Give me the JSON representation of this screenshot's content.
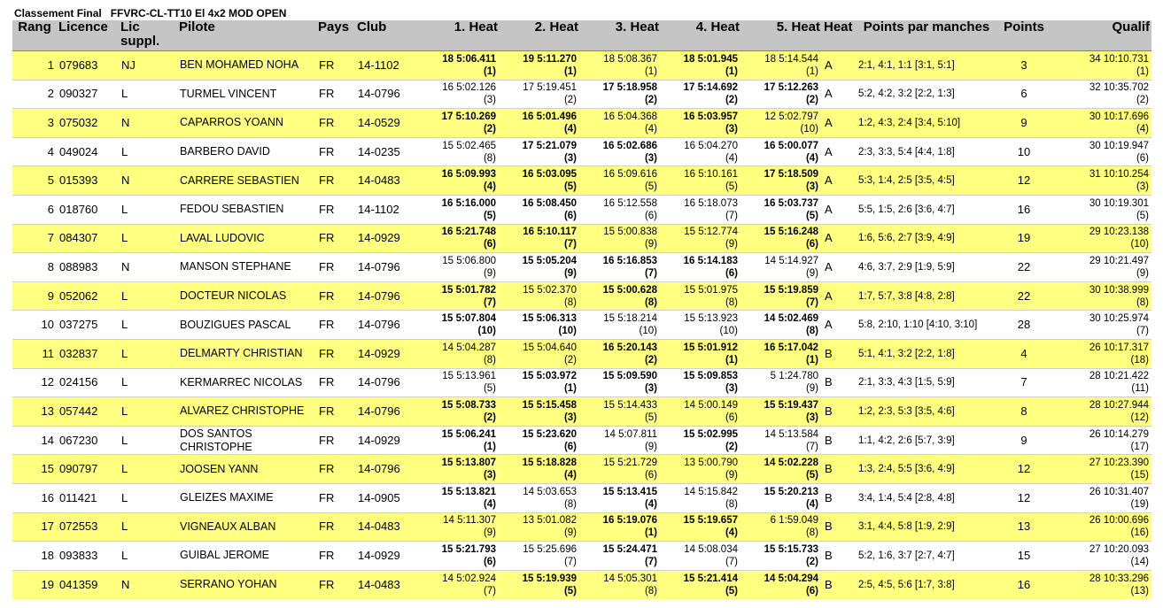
{
  "title": {
    "left": "Classement Final",
    "right": "FFVRC-CL-TT10 El 4x2 MOD OPEN"
  },
  "headers": [
    "Rang",
    "Licence",
    "Lic suppl.",
    "Pilote",
    "Pays",
    "Club",
    "1. Heat",
    "2. Heat",
    "3. Heat",
    "4. Heat",
    "5. Heat",
    "Heat",
    "Points par manches",
    "Points",
    "Qualif"
  ],
  "rows": [
    {
      "rang": "1",
      "licence": "079683",
      "lic": "NJ",
      "pilote": "BEN MOHAMED NOHA",
      "pays": "FR",
      "club": "14-1102",
      "heats": [
        {
          "t": "18 5:06.411",
          "p": "(1)",
          "b": true
        },
        {
          "t": "19 5:11.270",
          "p": "(1)",
          "b": true
        },
        {
          "t": "18 5:08.367",
          "p": "(1)",
          "b": false
        },
        {
          "t": "18 5:01.945",
          "p": "(1)",
          "b": true
        },
        {
          "t": "18 5:14.544",
          "p": "(1)",
          "b": false
        }
      ],
      "heat": "A",
      "pm": "2:1, 4:1, 1:1 [3:1, 5:1]",
      "points": "3",
      "q1": "34 10:10.731",
      "q2": "(1)"
    },
    {
      "rang": "2",
      "licence": "090327",
      "lic": "L",
      "pilote": "TURMEL VINCENT",
      "pays": "FR",
      "club": "14-0796",
      "heats": [
        {
          "t": "16 5:02.126",
          "p": "(3)",
          "b": false
        },
        {
          "t": "17 5:19.451",
          "p": "(2)",
          "b": false
        },
        {
          "t": "17 5:18.958",
          "p": "(2)",
          "b": true
        },
        {
          "t": "17 5:14.692",
          "p": "(2)",
          "b": true
        },
        {
          "t": "17 5:12.263",
          "p": "(2)",
          "b": true
        }
      ],
      "heat": "A",
      "pm": "5:2, 4:2, 3:2 [2:2, 1:3]",
      "points": "6",
      "q1": "32 10:35.702",
      "q2": "(2)"
    },
    {
      "rang": "3",
      "licence": "075032",
      "lic": "N",
      "pilote": "CAPARROS YOANN",
      "pays": "FR",
      "club": "14-0529",
      "heats": [
        {
          "t": "17 5:10.269",
          "p": "(2)",
          "b": true
        },
        {
          "t": "16 5:01.496",
          "p": "(4)",
          "b": true
        },
        {
          "t": "16 5:04.368",
          "p": "(4)",
          "b": false
        },
        {
          "t": "16 5:03.957",
          "p": "(3)",
          "b": true
        },
        {
          "t": "12 5:02.797",
          "p": "(10)",
          "b": false
        }
      ],
      "heat": "A",
      "pm": "1:2, 4:3, 2:4 [3:4, 5:10]",
      "points": "9",
      "q1": "30 10:17.696",
      "q2": "(4)"
    },
    {
      "rang": "4",
      "licence": "049024",
      "lic": "L",
      "pilote": "BARBERO DAVID",
      "pays": "FR",
      "club": "14-0235",
      "heats": [
        {
          "t": "15 5:02.465",
          "p": "(8)",
          "b": false
        },
        {
          "t": "17 5:21.079",
          "p": "(3)",
          "b": true
        },
        {
          "t": "16 5:02.686",
          "p": "(3)",
          "b": true
        },
        {
          "t": "16 5:04.270",
          "p": "(4)",
          "b": false
        },
        {
          "t": "16 5:00.077",
          "p": "(4)",
          "b": true
        }
      ],
      "heat": "A",
      "pm": "2:3, 3:3, 5:4 [4:4, 1:8]",
      "points": "10",
      "q1": "30 10:19.947",
      "q2": "(6)"
    },
    {
      "rang": "5",
      "licence": "015393",
      "lic": "N",
      "pilote": "CARRERE SEBASTIEN",
      "pays": "FR",
      "club": "14-0483",
      "heats": [
        {
          "t": "16 5:09.993",
          "p": "(4)",
          "b": true
        },
        {
          "t": "16 5:03.095",
          "p": "(5)",
          "b": true
        },
        {
          "t": "16 5:09.616",
          "p": "(5)",
          "b": false
        },
        {
          "t": "16 5:10.161",
          "p": "(5)",
          "b": false
        },
        {
          "t": "17 5:18.509",
          "p": "(3)",
          "b": true
        }
      ],
      "heat": "A",
      "pm": "5:3, 1:4, 2:5 [3:5, 4:5]",
      "points": "12",
      "q1": "31 10:10.254",
      "q2": "(3)"
    },
    {
      "rang": "6",
      "licence": "018760",
      "lic": "L",
      "pilote": "FEDOU SEBASTIEN",
      "pays": "FR",
      "club": "14-1102",
      "heats": [
        {
          "t": "16 5:16.000",
          "p": "(5)",
          "b": true
        },
        {
          "t": "16 5:08.450",
          "p": "(6)",
          "b": true
        },
        {
          "t": "16 5:12.558",
          "p": "(6)",
          "b": false
        },
        {
          "t": "16 5:18.073",
          "p": "(7)",
          "b": false
        },
        {
          "t": "16 5:03.737",
          "p": "(5)",
          "b": true
        }
      ],
      "heat": "A",
      "pm": "5:5, 1:5, 2:6 [3:6, 4:7]",
      "points": "16",
      "q1": "30 10:19.301",
      "q2": "(5)"
    },
    {
      "rang": "7",
      "licence": "084307",
      "lic": "L",
      "pilote": "LAVAL LUDOVIC",
      "pays": "FR",
      "club": "14-0929",
      "heats": [
        {
          "t": "16 5:21.748",
          "p": "(6)",
          "b": true
        },
        {
          "t": "16 5:10.117",
          "p": "(7)",
          "b": true
        },
        {
          "t": "15 5:00.838",
          "p": "(9)",
          "b": false
        },
        {
          "t": "15 5:12.774",
          "p": "(9)",
          "b": false
        },
        {
          "t": "15 5:16.248",
          "p": "(6)",
          "b": true
        }
      ],
      "heat": "A",
      "pm": "1:6, 5:6, 2:7 [3:9, 4:9]",
      "points": "19",
      "q1": "29 10:23.138",
      "q2": "(10)"
    },
    {
      "rang": "8",
      "licence": "088983",
      "lic": "N",
      "pilote": "MANSON STEPHANE",
      "pays": "FR",
      "club": "14-0796",
      "heats": [
        {
          "t": "15 5:06.800",
          "p": "(9)",
          "b": false
        },
        {
          "t": "15 5:05.204",
          "p": "(9)",
          "b": true
        },
        {
          "t": "16 5:16.853",
          "p": "(7)",
          "b": true
        },
        {
          "t": "16 5:14.183",
          "p": "(6)",
          "b": true
        },
        {
          "t": "14 5:14.927",
          "p": "(9)",
          "b": false
        }
      ],
      "heat": "A",
      "pm": "4:6, 3:7, 2:9 [1:9, 5:9]",
      "points": "22",
      "q1": "29 10:21.497",
      "q2": "(9)"
    },
    {
      "rang": "9",
      "licence": "052062",
      "lic": "L",
      "pilote": "DOCTEUR NICOLAS",
      "pays": "FR",
      "club": "14-0796",
      "heats": [
        {
          "t": "15 5:01.782",
          "p": "(7)",
          "b": true
        },
        {
          "t": "15 5:02.370",
          "p": "(8)",
          "b": false
        },
        {
          "t": "15 5:00.628",
          "p": "(8)",
          "b": true
        },
        {
          "t": "15 5:01.975",
          "p": "(8)",
          "b": false
        },
        {
          "t": "15 5:19.859",
          "p": "(7)",
          "b": true
        }
      ],
      "heat": "A",
      "pm": "1:7, 5:7, 3:8 [4:8, 2:8]",
      "points": "22",
      "q1": "30 10:38.999",
      "q2": "(8)"
    },
    {
      "rang": "10",
      "licence": "037275",
      "lic": "L",
      "pilote": "BOUZIGUES PASCAL",
      "pays": "FR",
      "club": "14-0796",
      "heats": [
        {
          "t": "15 5:07.804",
          "p": "(10)",
          "b": true
        },
        {
          "t": "15 5:06.313",
          "p": "(10)",
          "b": true
        },
        {
          "t": "15 5:18.214",
          "p": "(10)",
          "b": false
        },
        {
          "t": "15 5:13.923",
          "p": "(10)",
          "b": false
        },
        {
          "t": "14 5:02.469",
          "p": "(8)",
          "b": true
        }
      ],
      "heat": "A",
      "pm": "5:8, 2:10, 1:10 [4:10, 3:10]",
      "points": "28",
      "q1": "30 10:25.974",
      "q2": "(7)"
    },
    {
      "rang": "11",
      "licence": "032837",
      "lic": "L",
      "pilote": "DELMARTY CHRISTIAN",
      "pays": "FR",
      "club": "14-0929",
      "heats": [
        {
          "t": "14 5:04.287",
          "p": "(8)",
          "b": false
        },
        {
          "t": "15 5:04.640",
          "p": "(2)",
          "b": false
        },
        {
          "t": "16 5:20.143",
          "p": "(2)",
          "b": true
        },
        {
          "t": "15 5:01.912",
          "p": "(1)",
          "b": true
        },
        {
          "t": "16 5:17.042",
          "p": "(1)",
          "b": true
        }
      ],
      "heat": "B",
      "pm": "5:1, 4:1, 3:2 [2:2, 1:8]",
      "points": "4",
      "q1": "26 10:17.317",
      "q2": "(18)"
    },
    {
      "rang": "12",
      "licence": "024156",
      "lic": "L",
      "pilote": "KERMARREC NICOLAS",
      "pays": "FR",
      "club": "14-0796",
      "heats": [
        {
          "t": "15 5:13.961",
          "p": "(5)",
          "b": false
        },
        {
          "t": "15 5:03.972",
          "p": "(1)",
          "b": true
        },
        {
          "t": "15 5:09.590",
          "p": "(3)",
          "b": true
        },
        {
          "t": "15 5:09.853",
          "p": "(3)",
          "b": true
        },
        {
          "t": "5 1:24.780",
          "p": "(9)",
          "b": false
        }
      ],
      "heat": "B",
      "pm": "2:1, 3:3, 4:3 [1:5, 5:9]",
      "points": "7",
      "q1": "28 10:21.422",
      "q2": "(11)"
    },
    {
      "rang": "13",
      "licence": "057442",
      "lic": "L",
      "pilote": "ALVAREZ CHRISTOPHE",
      "pays": "FR",
      "club": "14-0796",
      "heats": [
        {
          "t": "15 5:08.733",
          "p": "(2)",
          "b": true
        },
        {
          "t": "15 5:15.458",
          "p": "(3)",
          "b": true
        },
        {
          "t": "15 5:14.433",
          "p": "(5)",
          "b": false
        },
        {
          "t": "14 5:00.149",
          "p": "(6)",
          "b": false
        },
        {
          "t": "15 5:19.437",
          "p": "(3)",
          "b": true
        }
      ],
      "heat": "B",
      "pm": "1:2, 2:3, 5:3 [3:5, 4:6]",
      "points": "8",
      "q1": "28 10:27.944",
      "q2": "(12)"
    },
    {
      "rang": "14",
      "licence": "067230",
      "lic": "L",
      "pilote": "DOS SANTOS CHRISTOPHE",
      "pays": "FR",
      "club": "14-0929",
      "heats": [
        {
          "t": "15 5:06.241",
          "p": "(1)",
          "b": true
        },
        {
          "t": "15 5:23.620",
          "p": "(6)",
          "b": true
        },
        {
          "t": "14 5:07.811",
          "p": "(9)",
          "b": false
        },
        {
          "t": "15 5:02.995",
          "p": "(2)",
          "b": true
        },
        {
          "t": "14 5:13.584",
          "p": "(7)",
          "b": false
        }
      ],
      "heat": "B",
      "pm": "1:1, 4:2, 2:6 [5:7, 3:9]",
      "points": "9",
      "q1": "26 10:14.279",
      "q2": "(17)"
    },
    {
      "rang": "15",
      "licence": "090797",
      "lic": "L",
      "pilote": "JOOSEN YANN",
      "pays": "FR",
      "club": "14-0796",
      "heats": [
        {
          "t": "15 5:13.807",
          "p": "(3)",
          "b": true
        },
        {
          "t": "15 5:18.828",
          "p": "(4)",
          "b": true
        },
        {
          "t": "15 5:21.729",
          "p": "(6)",
          "b": false
        },
        {
          "t": "13 5:00.790",
          "p": "(9)",
          "b": false
        },
        {
          "t": "14 5:02.228",
          "p": "(5)",
          "b": true
        }
      ],
      "heat": "B",
      "pm": "1:3, 2:4, 5:5 [3:6, 4:9]",
      "points": "12",
      "q1": "27 10:23.390",
      "q2": "(15)"
    },
    {
      "rang": "16",
      "licence": "011421",
      "lic": "L",
      "pilote": "GLEIZES MAXIME",
      "pays": "FR",
      "club": "14-0905",
      "heats": [
        {
          "t": "15 5:13.821",
          "p": "(4)",
          "b": true
        },
        {
          "t": "14 5:03.653",
          "p": "(8)",
          "b": false
        },
        {
          "t": "15 5:13.415",
          "p": "(4)",
          "b": true
        },
        {
          "t": "14 5:15.842",
          "p": "(8)",
          "b": false
        },
        {
          "t": "15 5:20.213",
          "p": "(4)",
          "b": true
        }
      ],
      "heat": "B",
      "pm": "3:4, 1:4, 5:4 [2:8, 4:8]",
      "points": "12",
      "q1": "26 10:31.407",
      "q2": "(19)"
    },
    {
      "rang": "17",
      "licence": "072553",
      "lic": "L",
      "pilote": "VIGNEAUX ALBAN",
      "pays": "FR",
      "club": "14-0483",
      "heats": [
        {
          "t": "14 5:11.307",
          "p": "(9)",
          "b": false
        },
        {
          "t": "13 5:01.082",
          "p": "(9)",
          "b": false
        },
        {
          "t": "16 5:19.076",
          "p": "(1)",
          "b": true
        },
        {
          "t": "15 5:19.657",
          "p": "(4)",
          "b": true
        },
        {
          "t": "6 1:59.049",
          "p": "(8)",
          "b": false
        }
      ],
      "heat": "B",
      "pm": "3:1, 4:4, 5:8 [1:9, 2:9]",
      "points": "13",
      "q1": "26 10:00.696",
      "q2": "(16)"
    },
    {
      "rang": "18",
      "licence": "093833",
      "lic": "L",
      "pilote": "GUIBAL JEROME",
      "pays": "FR",
      "club": "14-0929",
      "heats": [
        {
          "t": "15 5:21.793",
          "p": "(6)",
          "b": true
        },
        {
          "t": "15 5:25.696",
          "p": "(7)",
          "b": false
        },
        {
          "t": "15 5:24.471",
          "p": "(7)",
          "b": true
        },
        {
          "t": "14 5:08.034",
          "p": "(7)",
          "b": false
        },
        {
          "t": "15 5:15.733",
          "p": "(2)",
          "b": true
        }
      ],
      "heat": "B",
      "pm": "5:2, 1:6, 3:7 [2:7, 4:7]",
      "points": "15",
      "q1": "27 10:20.093",
      "q2": "(14)"
    },
    {
      "rang": "19",
      "licence": "041359",
      "lic": "N",
      "pilote": "SERRANO YOHAN",
      "pays": "FR",
      "club": "14-0483",
      "heats": [
        {
          "t": "14 5:02.924",
          "p": "(7)",
          "b": false
        },
        {
          "t": "15 5:19.939",
          "p": "(5)",
          "b": true
        },
        {
          "t": "14 5:05.301",
          "p": "(8)",
          "b": false
        },
        {
          "t": "15 5:21.414",
          "p": "(5)",
          "b": true
        },
        {
          "t": "14 5:04.294",
          "p": "(6)",
          "b": true
        }
      ],
      "heat": "B",
      "pm": "2:5, 4:5, 5:6 [1:7, 3:8]",
      "points": "16",
      "q1": "28 10:33.296",
      "q2": "(13)"
    }
  ],
  "colors": {
    "highlight": "#ffff80",
    "header": "#c5c5c5"
  }
}
